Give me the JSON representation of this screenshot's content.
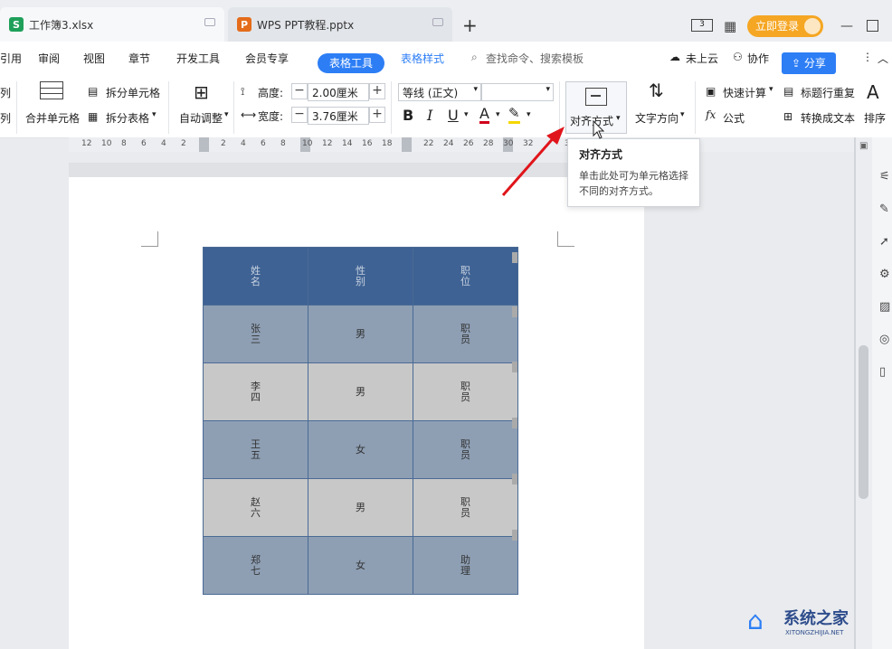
{
  "tabs": [
    {
      "label": "工作簿3.xlsx",
      "icon": "S",
      "color": "#1fa05a"
    },
    {
      "label": "WPS PPT教程.pptx",
      "icon": "P",
      "color": "#e46c1b"
    }
  ],
  "tab_add": "+",
  "login_label": "立即登录",
  "menu": {
    "items": [
      "引用",
      "审阅",
      "视图",
      "章节",
      "开发工具",
      "会员专享"
    ],
    "active": "表格工具",
    "table_style": "表格样式",
    "search": "查找命令、搜索模板",
    "cloud": "未上云",
    "collab": "协作",
    "share": "分享"
  },
  "ribbon": {
    "left_col": [
      "列",
      "列"
    ],
    "merge_cells": "合并单元格",
    "split_cells": "拆分单元格",
    "split_table": "拆分表格",
    "auto_adjust": "自动调整",
    "height_label": "高度:",
    "height_value": "2.00厘米",
    "width_label": "宽度:",
    "width_value": "3.76厘米",
    "font_name": "等线 (正文)",
    "font_size": "",
    "bold": "B",
    "italic": "I",
    "underline": "U",
    "font_color": "A",
    "align": "对齐方式",
    "text_dir": "文字方向",
    "quick_calc": "快速计算",
    "formula": "公式",
    "formula_fx": "fx",
    "title_repeat": "标题行重复",
    "to_text": "转换成文本",
    "sort": "排序"
  },
  "ruler_ticks": [
    "12",
    "10",
    "8",
    "6",
    "4",
    "2",
    "2",
    "4",
    "6",
    "8",
    "10",
    "12",
    "14",
    "16",
    "18",
    "22",
    "24",
    "26",
    "28",
    "30",
    "32",
    "36",
    "38"
  ],
  "tooltip": {
    "title": "对齐方式",
    "body": "单击此处可为单元格选择不同的对齐方式。"
  },
  "table": {
    "header": [
      "姓名",
      "性别",
      "职位"
    ],
    "rows": [
      [
        "张三",
        "男",
        "职员"
      ],
      [
        "李四",
        "男",
        "职员"
      ],
      [
        "王五",
        "女",
        "职员"
      ],
      [
        "赵六",
        "男",
        "职员"
      ],
      [
        "郑七",
        "女",
        "助理"
      ]
    ],
    "header_color": "#3e6293",
    "row_colors": [
      "#8e9fb4",
      "#c8c8c8"
    ]
  },
  "watermark": {
    "name": "系统之家",
    "url": "XITONGZHIJIA.NET"
  }
}
